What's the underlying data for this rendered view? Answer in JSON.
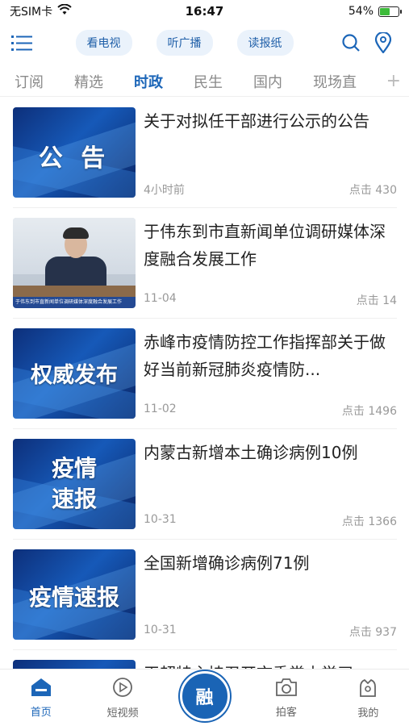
{
  "status_bar": {
    "carrier": "无SIM卡",
    "time": "16:47",
    "battery": "54%",
    "battery_level": 0.54
  },
  "toolbar": {
    "pills": [
      "看电视",
      "听广播",
      "读报纸"
    ],
    "icons": [
      "menu-icon",
      "search-icon",
      "location-icon"
    ]
  },
  "tabs": {
    "items": [
      "订阅",
      "精选",
      "时政",
      "民生",
      "国内",
      "现场直"
    ],
    "active": "时政",
    "more": "+"
  },
  "feed": {
    "items": [
      {
        "title": "关于对拟任干部进行公示的公告",
        "time": "4小时前",
        "clicks": "点击 430",
        "thumb_text": "公  告"
      },
      {
        "title": "于伟东到市直新闻单位调研媒体深度融合发展工作",
        "time": "11-04",
        "clicks": "点击 14",
        "thumb_text": "于伟东到市直新闻单位调研媒体深度融合发展工作"
      },
      {
        "title": "赤峰市疫情防控工作指挥部关于做好当前新冠肺炎疫情防...",
        "time": "11-02",
        "clicks": "点击 1496",
        "thumb_text": "权威发布"
      },
      {
        "title": "内蒙古新增本土确诊病例10例",
        "time": "10-31",
        "clicks": "点击 1366",
        "thumb_text": "疫情\n速报"
      },
      {
        "title": "全国新增确诊病例71例",
        "time": "10-31",
        "clicks": "点击 937",
        "thumb_text": "疫情速报"
      },
      {
        "title": "王超特主持召开市委常由学习",
        "time": "",
        "clicks": "",
        "thumb_text": ""
      }
    ]
  },
  "bottom_nav": {
    "items": [
      {
        "label": "首页",
        "icon": "home-icon"
      },
      {
        "label": "短视频",
        "icon": "play-icon"
      },
      {
        "label": "融",
        "icon": "center-logo"
      },
      {
        "label": "拍客",
        "icon": "camera-icon"
      },
      {
        "label": "我的",
        "icon": "profile-icon"
      }
    ],
    "active": "首页"
  },
  "colors": {
    "accent": "#1c66b8",
    "pill_bg": "#eaf2fb",
    "battery_green": "#3dbb3a"
  }
}
